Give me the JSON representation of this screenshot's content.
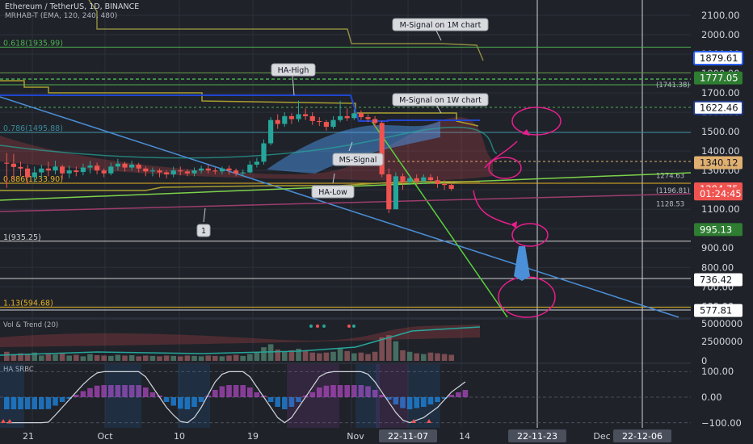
{
  "chart_data": [
    {
      "type": "candlestick",
      "title": "Ethereum / TetherUS, 1D, BINANCE",
      "indicator": "MRHAB-T (EMA, 120, 240, 480)",
      "x_axis": {
        "ticks": [
          "21",
          "Oct",
          "10",
          "19",
          "Nov",
          "22-11-07",
          "14",
          "22-11-23",
          "Dec",
          "22-12-06"
        ]
      },
      "y_axis": {
        "ticks": [
          "2100.00",
          "2000.00",
          "1900.00",
          "1800.00",
          "1700.00",
          "1600.00",
          "1500.00",
          "1400.00",
          "1300.00",
          "1200.00",
          "1100.00",
          "1000.00",
          "900.00",
          "800.00",
          "700.00",
          "600.00"
        ],
        "ylim": [
          560,
          2160
        ]
      },
      "price_badges": [
        {
          "text": "1879.61",
          "value": 1879.61,
          "bg": "#ffffff",
          "fg": "#131722",
          "border": "#2962ff"
        },
        {
          "text": "1777.05",
          "value": 1777.05,
          "bg": "#2e7d32",
          "fg": "#ffffff"
        },
        {
          "text": "1622.46",
          "value": 1622.46,
          "bg": "#ffffff",
          "fg": "#131722",
          "border": "#1e3a8a"
        },
        {
          "text": "1340.12",
          "value": 1340.12,
          "bg": "#e0b070",
          "fg": "#131722"
        },
        {
          "text": "1204.75",
          "value": 1204.75,
          "bg": "#ef5350",
          "fg": "#ffffff"
        },
        {
          "text": "01:24:45",
          "value": 1179,
          "bg": "#ef5350",
          "fg": "#ffffff"
        },
        {
          "text": "995.13",
          "value": 995.13,
          "bg": "#2e7d32",
          "fg": "#ffffff"
        },
        {
          "text": "736.42",
          "value": 736.42,
          "bg": "#ffffff",
          "fg": "#131722"
        },
        {
          "text": "577.81",
          "value": 577.81,
          "bg": "#ffffff",
          "fg": "#131722"
        }
      ],
      "fib_levels": [
        {
          "label": "0.618(1935.99)",
          "value": 1935.99,
          "color": "#4caf50"
        },
        {
          "label": "0.786(1495.88)",
          "value": 1495.88,
          "color": "#3a8a9a"
        },
        {
          "label": "0.886(1233.90)",
          "value": 1233.9,
          "color": "#e6b422"
        },
        {
          "label": "1(935.25)",
          "value": 935.25,
          "color": "#cfcfcf"
        },
        {
          "label": "1.13(594.68)",
          "value": 594.68,
          "color": "#e6b422"
        }
      ],
      "small_level_labels": [
        {
          "text": "1274.63",
          "value": 1274.63
        },
        {
          "text": "(1196.81)",
          "value": 1196.81
        },
        {
          "text": "1128.53",
          "value": 1128.53
        },
        {
          "text": "(1741.38)",
          "value": 1741.38
        }
      ],
      "annotations": [
        "M-Signal on 1M chart",
        "HA-High",
        "M-Signal on 1W chart",
        "MS-Signal",
        "HA-Low",
        "1"
      ],
      "candles": [
        [
          1340,
          1335,
          1390,
          1210
        ],
        [
          1335,
          1318,
          1385,
          1250
        ],
        [
          1318,
          1310,
          1345,
          1270
        ],
        [
          1310,
          1265,
          1330,
          1230
        ],
        [
          1265,
          1290,
          1320,
          1240
        ],
        [
          1290,
          1310,
          1330,
          1260
        ],
        [
          1310,
          1300,
          1345,
          1270
        ],
        [
          1300,
          1320,
          1350,
          1280
        ],
        [
          1320,
          1285,
          1330,
          1255
        ],
        [
          1285,
          1300,
          1325,
          1260
        ],
        [
          1300,
          1292,
          1320,
          1270
        ],
        [
          1292,
          1315,
          1335,
          1275
        ],
        [
          1315,
          1325,
          1350,
          1285
        ],
        [
          1325,
          1300,
          1340,
          1280
        ],
        [
          1300,
          1285,
          1310,
          1265
        ],
        [
          1285,
          1320,
          1340,
          1275
        ],
        [
          1320,
          1335,
          1360,
          1300
        ],
        [
          1335,
          1315,
          1345,
          1295
        ],
        [
          1315,
          1330,
          1350,
          1300
        ],
        [
          1330,
          1310,
          1340,
          1290
        ],
        [
          1310,
          1295,
          1320,
          1270
        ],
        [
          1295,
          1300,
          1315,
          1270
        ],
        [
          1300,
          1290,
          1310,
          1265
        ],
        [
          1290,
          1280,
          1300,
          1260
        ],
        [
          1280,
          1300,
          1320,
          1265
        ],
        [
          1300,
          1295,
          1320,
          1275
        ],
        [
          1295,
          1285,
          1305,
          1270
        ],
        [
          1285,
          1300,
          1315,
          1270
        ],
        [
          1300,
          1310,
          1325,
          1285
        ],
        [
          1310,
          1300,
          1330,
          1285
        ],
        [
          1300,
          1295,
          1315,
          1280
        ],
        [
          1295,
          1310,
          1320,
          1280
        ],
        [
          1310,
          1300,
          1325,
          1280
        ],
        [
          1300,
          1285,
          1310,
          1270
        ],
        [
          1285,
          1290,
          1305,
          1270
        ],
        [
          1290,
          1330,
          1350,
          1285
        ],
        [
          1330,
          1345,
          1365,
          1315
        ],
        [
          1345,
          1440,
          1460,
          1330
        ],
        [
          1440,
          1560,
          1575,
          1430
        ],
        [
          1560,
          1540,
          1590,
          1515
        ],
        [
          1540,
          1580,
          1600,
          1525
        ],
        [
          1580,
          1565,
          1595,
          1540
        ],
        [
          1565,
          1590,
          1660,
          1550
        ],
        [
          1590,
          1580,
          1620,
          1560
        ],
        [
          1580,
          1555,
          1600,
          1535
        ],
        [
          1555,
          1550,
          1575,
          1530
        ],
        [
          1550,
          1525,
          1560,
          1505
        ],
        [
          1525,
          1560,
          1580,
          1515
        ],
        [
          1560,
          1580,
          1660,
          1550
        ],
        [
          1580,
          1570,
          1620,
          1555
        ],
        [
          1570,
          1595,
          1615,
          1560
        ],
        [
          1595,
          1575,
          1610,
          1560
        ],
        [
          1575,
          1565,
          1590,
          1550
        ],
        [
          1565,
          1545,
          1580,
          1520
        ],
        [
          1545,
          1280,
          1555,
          1265
        ],
        [
          1280,
          1100,
          1310,
          1080
        ],
        [
          1100,
          1270,
          1290,
          1100
        ],
        [
          1270,
          1240,
          1285,
          1200
        ],
        [
          1240,
          1260,
          1275,
          1225
        ],
        [
          1260,
          1245,
          1280,
          1225
        ],
        [
          1245,
          1265,
          1280,
          1230
        ],
        [
          1265,
          1250,
          1280,
          1235
        ],
        [
          1250,
          1230,
          1270,
          1210
        ],
        [
          1230,
          1225,
          1250,
          1200
        ],
        [
          1225,
          1205,
          1245,
          1195
        ]
      ]
    },
    {
      "type": "bar",
      "title": "Vol & Trend (20)",
      "y_axis": {
        "ticks": [
          "5000000",
          "2500000",
          "0"
        ],
        "ylim": [
          0,
          5000000
        ]
      },
      "values": [
        1200000,
        900000,
        1000000,
        800000,
        1100000,
        700000,
        900000,
        850000,
        950000,
        700000,
        800000,
        600000,
        900000,
        750000,
        700000,
        650000,
        800000,
        700000,
        750000,
        600000,
        700000,
        650000,
        600000,
        700000,
        650000,
        600000,
        700000,
        650000,
        600000,
        700000,
        650000,
        600000,
        700000,
        800000,
        650000,
        900000,
        1100000,
        1800000,
        2200000,
        1500000,
        1200000,
        1400000,
        1600000,
        1300000,
        1100000,
        1000000,
        1100000,
        1200000,
        1600000,
        1300000,
        1000000,
        1100000,
        900000,
        1200000,
        3100000,
        3400000,
        2600000,
        1400000,
        1200000,
        1000000,
        900000,
        1100000,
        1000000,
        900000,
        800000
      ]
    },
    {
      "type": "line",
      "title": "HA SRBC",
      "y_axis": {
        "ticks": [
          "100.00",
          "0.00",
          "−100.00"
        ],
        "ylim": [
          -120,
          120
        ]
      },
      "series": [
        {
          "values": [
            -100,
            -100,
            -100,
            -100,
            -100,
            -100,
            -98,
            -70,
            -40,
            -10,
            20,
            50,
            75,
            95,
            100,
            100,
            100,
            100,
            100,
            100,
            80,
            40,
            0,
            -40,
            -70,
            -95,
            -100,
            -80,
            -40,
            10,
            60,
            90,
            100,
            100,
            100,
            80,
            40,
            0,
            -40,
            -80,
            -100,
            -80,
            -40,
            0,
            40,
            80,
            95,
            100,
            100,
            100,
            100,
            100,
            90,
            60,
            20,
            -20,
            -60,
            -90,
            -100,
            -90,
            -80,
            -60,
            -40,
            -10,
            20,
            40,
            60
          ]
        }
      ]
    }
  ]
}
